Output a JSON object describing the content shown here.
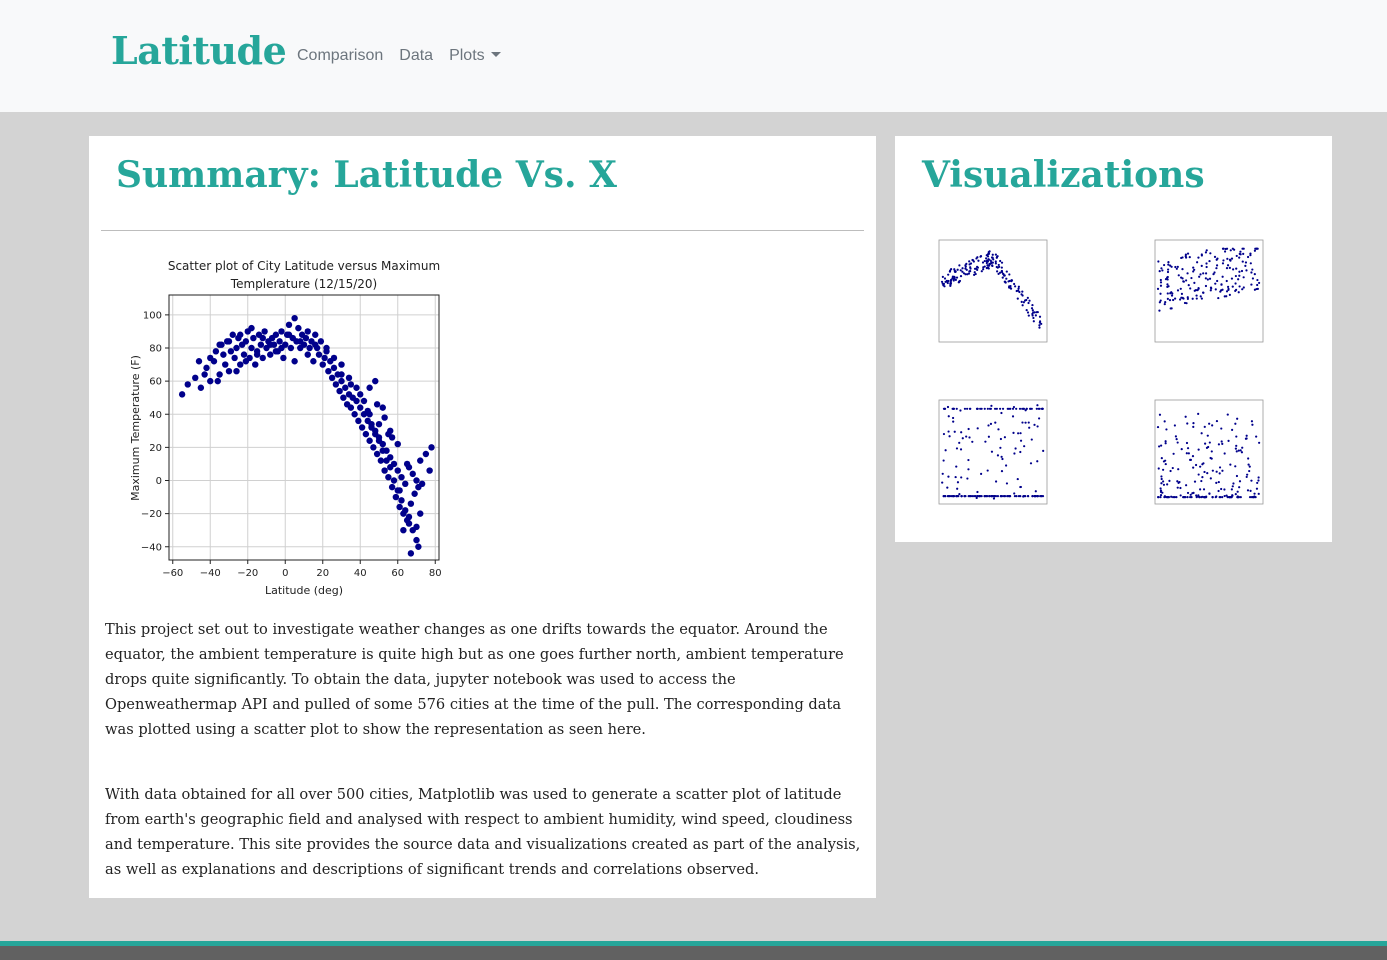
{
  "navbar": {
    "brand": "Latitude",
    "links": [
      "Comparison",
      "Data",
      "Plots"
    ]
  },
  "summary": {
    "title": "Summary: Latitude Vs. X",
    "paragraph1": "This project set out to investigate weather changes as one drifts towards the equator. Around the equator, the ambient temperature is quite high but as one goes further north, ambient temperature drops quite significantly. To obtain the data, jupyter notebook was used to access the Openweathermap API and pulled of some 576 cities at the time of the pull. The corresponding data was plotted using a scatter plot to show the representation as seen here.",
    "paragraph2": "With data obtained for all over 500 cities, Matplotlib was used to generate a scatter plot of latitude from earth's geographic field and analysed with respect to ambient humidity, wind speed, cloudiness and temperature. This site provides the source data and visualizations created as part of the analysis, as well as explanations and descriptions of significant trends and correlations observed."
  },
  "visualizations": {
    "title": "Visualizations"
  },
  "colors": {
    "accent": "#26a69a",
    "marker": "#00008b",
    "footer": "#616161"
  },
  "chart_data": [
    {
      "type": "scatter",
      "title": "Scatter plot of City Latitude versus Maximum Templerature (12/15/20)",
      "title_lines": [
        "Scatter plot of City Latitude versus Maximum",
        "Templerature (12/15/20)"
      ],
      "xlabel": "Latitude (deg)",
      "ylabel": "Maximum Temperature (F)",
      "xlim": [
        -62,
        82
      ],
      "ylim": [
        -48,
        112
      ],
      "xticks": [
        -60,
        -40,
        -20,
        0,
        20,
        40,
        60,
        80
      ],
      "yticks": [
        -40,
        -20,
        0,
        20,
        40,
        60,
        80,
        100
      ],
      "grid": true,
      "x": [
        -55,
        -52,
        -48,
        -46,
        -45,
        -43,
        -42,
        -40,
        -40,
        -38,
        -37,
        -35,
        -35,
        -33,
        -32,
        -30,
        -30,
        -29,
        -28,
        -27,
        -26,
        -25,
        -24,
        -23,
        -22,
        -21,
        -20,
        -19,
        -18,
        -17,
        -16,
        -15,
        -14,
        -13,
        -12,
        -11,
        -10,
        -9,
        -8,
        -7,
        -6,
        -5,
        -4,
        -3,
        -2,
        -1,
        0,
        1,
        2,
        3,
        4,
        5,
        6,
        7,
        8,
        9,
        10,
        11,
        12,
        13,
        14,
        15,
        16,
        17,
        18,
        19,
        20,
        21,
        22,
        23,
        24,
        25,
        26,
        27,
        28,
        29,
        30,
        31,
        32,
        33,
        34,
        35,
        36,
        37,
        38,
        39,
        40,
        41,
        42,
        43,
        44,
        45,
        46,
        47,
        48,
        49,
        50,
        51,
        52,
        53,
        54,
        55,
        56,
        57,
        58,
        59,
        60,
        61,
        62,
        63,
        64,
        65,
        66,
        67,
        68,
        69,
        70,
        71,
        72,
        73,
        75,
        77,
        78,
        -36,
        -34,
        -31,
        -26,
        -24,
        -21,
        -18,
        -15,
        -12,
        -8,
        -5,
        -2,
        2,
        5,
        8,
        12,
        16,
        22,
        26,
        30,
        34,
        38,
        42,
        44,
        46,
        48,
        50,
        52,
        54,
        56,
        58,
        60,
        62,
        64,
        66,
        68,
        70,
        72,
        30,
        35,
        40,
        45,
        50,
        55,
        60,
        65,
        70,
        48,
        52,
        56,
        61,
        66,
        71,
        45,
        49,
        53,
        57,
        63,
        67
      ],
      "y": [
        52,
        58,
        62,
        72,
        56,
        64,
        68,
        74,
        60,
        72,
        78,
        64,
        82,
        76,
        70,
        84,
        66,
        78,
        88,
        74,
        80,
        86,
        70,
        82,
        76,
        84,
        90,
        74,
        80,
        86,
        70,
        78,
        88,
        82,
        74,
        90,
        80,
        84,
        76,
        86,
        82,
        88,
        78,
        84,
        90,
        74,
        82,
        88,
        94,
        80,
        86,
        98,
        84,
        92,
        80,
        88,
        82,
        86,
        90,
        80,
        84,
        72,
        88,
        80,
        76,
        84,
        70,
        74,
        78,
        66,
        72,
        62,
        68,
        58,
        64,
        54,
        60,
        50,
        56,
        46,
        52,
        44,
        50,
        40,
        48,
        36,
        44,
        32,
        40,
        28,
        36,
        24,
        32,
        20,
        28,
        16,
        26,
        12,
        22,
        6,
        18,
        2,
        14,
        -4,
        10,
        -10,
        6,
        -16,
        2,
        -20,
        -2,
        -24,
        8,
        -14,
        4,
        -8,
        0,
        -4,
        12,
        -2,
        16,
        6,
        20,
        60,
        82,
        84,
        66,
        88,
        72,
        92,
        76,
        86,
        82,
        78,
        80,
        88,
        72,
        84,
        76,
        82,
        80,
        74,
        70,
        62,
        56,
        48,
        42,
        34,
        30,
        24,
        18,
        12,
        8,
        0,
        -6,
        -12,
        -18,
        -26,
        -30,
        -36,
        -20,
        64,
        58,
        52,
        40,
        34,
        28,
        22,
        10,
        -28,
        60,
        44,
        30,
        -6,
        -22,
        -40,
        56,
        46,
        38,
        26,
        -30,
        -44
      ]
    }
  ]
}
